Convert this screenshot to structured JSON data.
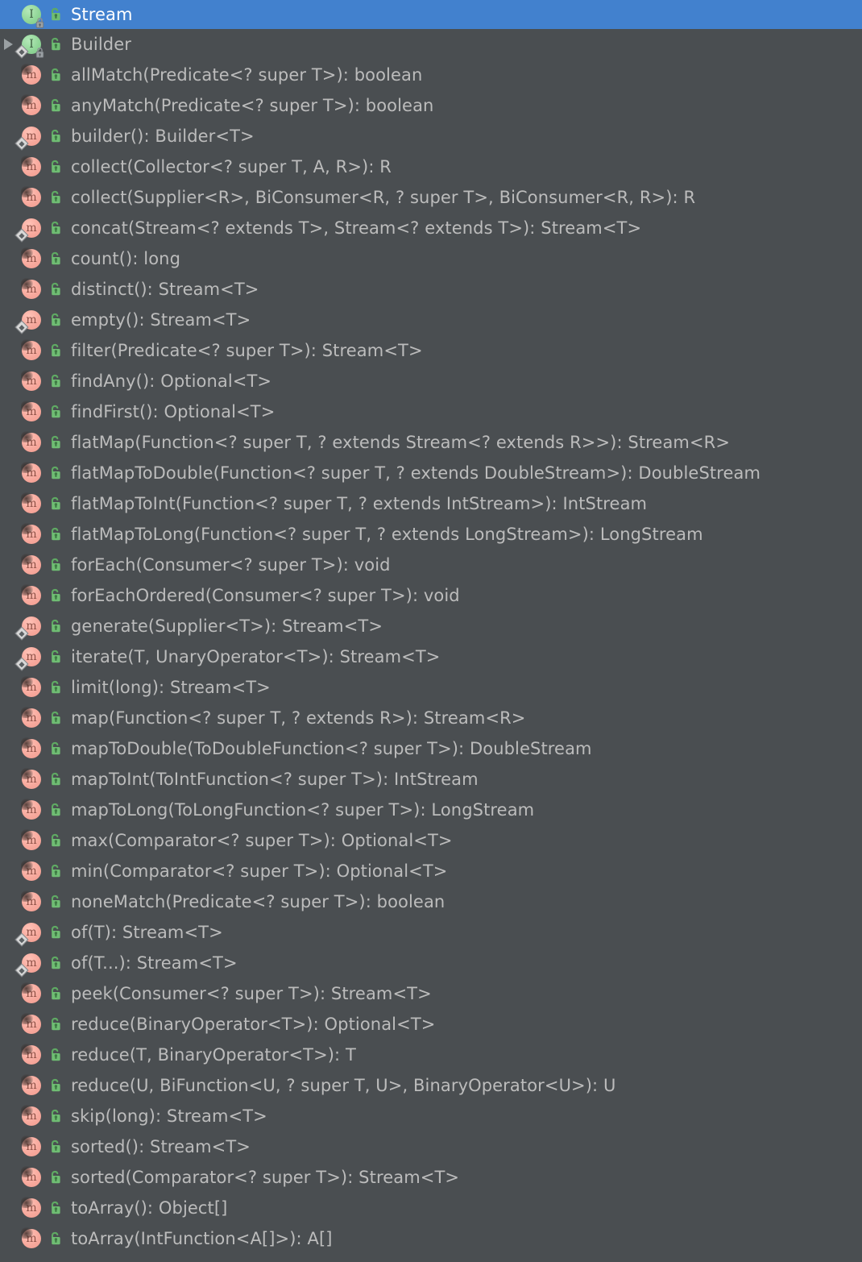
{
  "window": {
    "title": "Stream",
    "kind": "structure-tree",
    "theme": "darcula",
    "colors": {
      "background": "#4a4e51",
      "selection": "#4281ce",
      "text": "#bcbcbc",
      "selected_text": "#ffffff",
      "interface_icon": "#8fd596",
      "method_icon": "#f7a79b",
      "lock_icon": "#6aba6e",
      "expander": "#9aa0a3"
    }
  },
  "tree": {
    "root": {
      "label": "Stream",
      "icon": "interface-icon",
      "modifier_icon": "unlocked-padlock-icon",
      "selected": true,
      "expanded": true,
      "has_lock_badge": true
    },
    "nodes": [
      {
        "label": "Builder",
        "icon": "interface-icon",
        "modifier_icon": "unlocked-padlock-icon",
        "expandable": true,
        "expanded": false,
        "static": true,
        "has_lock_badge": true,
        "abstract": false
      },
      {
        "label": "allMatch(Predicate<? super T>): boolean",
        "icon": "method-icon",
        "modifier_icon": "unlocked-padlock-icon",
        "static": false,
        "abstract": true
      },
      {
        "label": "anyMatch(Predicate<? super T>): boolean",
        "icon": "method-icon",
        "modifier_icon": "unlocked-padlock-icon",
        "static": false,
        "abstract": true
      },
      {
        "label": "builder(): Builder<T>",
        "icon": "method-icon",
        "modifier_icon": "unlocked-padlock-icon",
        "static": true,
        "abstract": false
      },
      {
        "label": "collect(Collector<? super T, A, R>): R",
        "icon": "method-icon",
        "modifier_icon": "unlocked-padlock-icon",
        "static": false,
        "abstract": true
      },
      {
        "label": "collect(Supplier<R>, BiConsumer<R, ? super T>, BiConsumer<R, R>): R",
        "icon": "method-icon",
        "modifier_icon": "unlocked-padlock-icon",
        "static": false,
        "abstract": true
      },
      {
        "label": "concat(Stream<? extends T>, Stream<? extends T>): Stream<T>",
        "icon": "method-icon",
        "modifier_icon": "unlocked-padlock-icon",
        "static": true,
        "abstract": false
      },
      {
        "label": "count(): long",
        "icon": "method-icon",
        "modifier_icon": "unlocked-padlock-icon",
        "static": false,
        "abstract": true
      },
      {
        "label": "distinct(): Stream<T>",
        "icon": "method-icon",
        "modifier_icon": "unlocked-padlock-icon",
        "static": false,
        "abstract": true
      },
      {
        "label": "empty(): Stream<T>",
        "icon": "method-icon",
        "modifier_icon": "unlocked-padlock-icon",
        "static": true,
        "abstract": false
      },
      {
        "label": "filter(Predicate<? super T>): Stream<T>",
        "icon": "method-icon",
        "modifier_icon": "unlocked-padlock-icon",
        "static": false,
        "abstract": true
      },
      {
        "label": "findAny(): Optional<T>",
        "icon": "method-icon",
        "modifier_icon": "unlocked-padlock-icon",
        "static": false,
        "abstract": true
      },
      {
        "label": "findFirst(): Optional<T>",
        "icon": "method-icon",
        "modifier_icon": "unlocked-padlock-icon",
        "static": false,
        "abstract": true
      },
      {
        "label": "flatMap(Function<? super T, ? extends Stream<? extends R>>): Stream<R>",
        "icon": "method-icon",
        "modifier_icon": "unlocked-padlock-icon",
        "static": false,
        "abstract": true
      },
      {
        "label": "flatMapToDouble(Function<? super T, ? extends DoubleStream>): DoubleStream",
        "icon": "method-icon",
        "modifier_icon": "unlocked-padlock-icon",
        "static": false,
        "abstract": true
      },
      {
        "label": "flatMapToInt(Function<? super T, ? extends IntStream>): IntStream",
        "icon": "method-icon",
        "modifier_icon": "unlocked-padlock-icon",
        "static": false,
        "abstract": true
      },
      {
        "label": "flatMapToLong(Function<? super T, ? extends LongStream>): LongStream",
        "icon": "method-icon",
        "modifier_icon": "unlocked-padlock-icon",
        "static": false,
        "abstract": true
      },
      {
        "label": "forEach(Consumer<? super T>): void",
        "icon": "method-icon",
        "modifier_icon": "unlocked-padlock-icon",
        "static": false,
        "abstract": true
      },
      {
        "label": "forEachOrdered(Consumer<? super T>): void",
        "icon": "method-icon",
        "modifier_icon": "unlocked-padlock-icon",
        "static": false,
        "abstract": true
      },
      {
        "label": "generate(Supplier<T>): Stream<T>",
        "icon": "method-icon",
        "modifier_icon": "unlocked-padlock-icon",
        "static": true,
        "abstract": false
      },
      {
        "label": "iterate(T, UnaryOperator<T>): Stream<T>",
        "icon": "method-icon",
        "modifier_icon": "unlocked-padlock-icon",
        "static": true,
        "abstract": false
      },
      {
        "label": "limit(long): Stream<T>",
        "icon": "method-icon",
        "modifier_icon": "unlocked-padlock-icon",
        "static": false,
        "abstract": true
      },
      {
        "label": "map(Function<? super T, ? extends R>): Stream<R>",
        "icon": "method-icon",
        "modifier_icon": "unlocked-padlock-icon",
        "static": false,
        "abstract": true
      },
      {
        "label": "mapToDouble(ToDoubleFunction<? super T>): DoubleStream",
        "icon": "method-icon",
        "modifier_icon": "unlocked-padlock-icon",
        "static": false,
        "abstract": true
      },
      {
        "label": "mapToInt(ToIntFunction<? super T>): IntStream",
        "icon": "method-icon",
        "modifier_icon": "unlocked-padlock-icon",
        "static": false,
        "abstract": true
      },
      {
        "label": "mapToLong(ToLongFunction<? super T>): LongStream",
        "icon": "method-icon",
        "modifier_icon": "unlocked-padlock-icon",
        "static": false,
        "abstract": true
      },
      {
        "label": "max(Comparator<? super T>): Optional<T>",
        "icon": "method-icon",
        "modifier_icon": "unlocked-padlock-icon",
        "static": false,
        "abstract": true
      },
      {
        "label": "min(Comparator<? super T>): Optional<T>",
        "icon": "method-icon",
        "modifier_icon": "unlocked-padlock-icon",
        "static": false,
        "abstract": true
      },
      {
        "label": "noneMatch(Predicate<? super T>): boolean",
        "icon": "method-icon",
        "modifier_icon": "unlocked-padlock-icon",
        "static": false,
        "abstract": true
      },
      {
        "label": "of(T): Stream<T>",
        "icon": "method-icon",
        "modifier_icon": "unlocked-padlock-icon",
        "static": true,
        "abstract": false
      },
      {
        "label": "of(T...): Stream<T>",
        "icon": "method-icon",
        "modifier_icon": "unlocked-padlock-icon",
        "static": true,
        "abstract": false
      },
      {
        "label": "peek(Consumer<? super T>): Stream<T>",
        "icon": "method-icon",
        "modifier_icon": "unlocked-padlock-icon",
        "static": false,
        "abstract": true
      },
      {
        "label": "reduce(BinaryOperator<T>): Optional<T>",
        "icon": "method-icon",
        "modifier_icon": "unlocked-padlock-icon",
        "static": false,
        "abstract": true
      },
      {
        "label": "reduce(T, BinaryOperator<T>): T",
        "icon": "method-icon",
        "modifier_icon": "unlocked-padlock-icon",
        "static": false,
        "abstract": true
      },
      {
        "label": "reduce(U, BiFunction<U, ? super T, U>, BinaryOperator<U>): U",
        "icon": "method-icon",
        "modifier_icon": "unlocked-padlock-icon",
        "static": false,
        "abstract": true
      },
      {
        "label": "skip(long): Stream<T>",
        "icon": "method-icon",
        "modifier_icon": "unlocked-padlock-icon",
        "static": false,
        "abstract": true
      },
      {
        "label": "sorted(): Stream<T>",
        "icon": "method-icon",
        "modifier_icon": "unlocked-padlock-icon",
        "static": false,
        "abstract": true
      },
      {
        "label": "sorted(Comparator<? super T>): Stream<T>",
        "icon": "method-icon",
        "modifier_icon": "unlocked-padlock-icon",
        "static": false,
        "abstract": true
      },
      {
        "label": "toArray(): Object[]",
        "icon": "method-icon",
        "modifier_icon": "unlocked-padlock-icon",
        "static": false,
        "abstract": true
      },
      {
        "label": "toArray(IntFunction<A[]>): A[]",
        "icon": "method-icon",
        "modifier_icon": "unlocked-padlock-icon",
        "static": false,
        "abstract": true
      }
    ]
  },
  "glyphs": {
    "interface_letter": "I",
    "method_letter": "m"
  }
}
